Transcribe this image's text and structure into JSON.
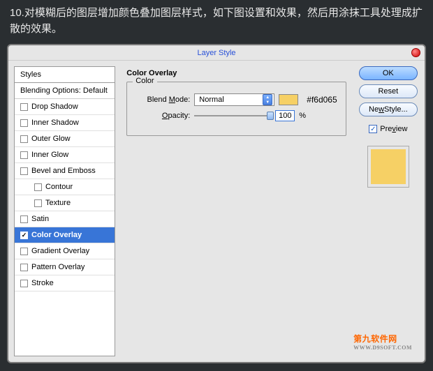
{
  "instruction": "10.对模糊后的图层增加颜色叠加图层样式，如下图设置和效果，然后用涂抹工具处理成扩散的效果。",
  "dialog": {
    "title": "Layer Style",
    "styles_header": "Styles",
    "blending": "Blending Options: Default",
    "items": [
      {
        "label": "Drop Shadow",
        "checked": false
      },
      {
        "label": "Inner Shadow",
        "checked": false
      },
      {
        "label": "Outer Glow",
        "checked": false
      },
      {
        "label": "Inner Glow",
        "checked": false
      },
      {
        "label": "Bevel and Emboss",
        "checked": false
      },
      {
        "label": "Contour",
        "checked": false,
        "indent": true
      },
      {
        "label": "Texture",
        "checked": false,
        "indent": true
      },
      {
        "label": "Satin",
        "checked": false
      },
      {
        "label": "Color Overlay",
        "checked": true,
        "selected": true
      },
      {
        "label": "Gradient Overlay",
        "checked": false
      },
      {
        "label": "Pattern Overlay",
        "checked": false
      },
      {
        "label": "Stroke",
        "checked": false
      }
    ]
  },
  "settings": {
    "section": "Color Overlay",
    "fieldset": "Color",
    "blend_mode_label": "Blend Mode:",
    "blend_mode_value": "Normal",
    "swatch_color": "#f6d065",
    "hex_text": "#f6d065",
    "opacity_label": "Opacity:",
    "opacity_value": "100",
    "opacity_unit": "%"
  },
  "buttons": {
    "ok": "OK",
    "reset": "Reset",
    "new_style": "New Style...",
    "preview": "Preview"
  },
  "watermark": {
    "main": "第九软件网",
    "sub": "WWW.D9SOFT.COM"
  }
}
